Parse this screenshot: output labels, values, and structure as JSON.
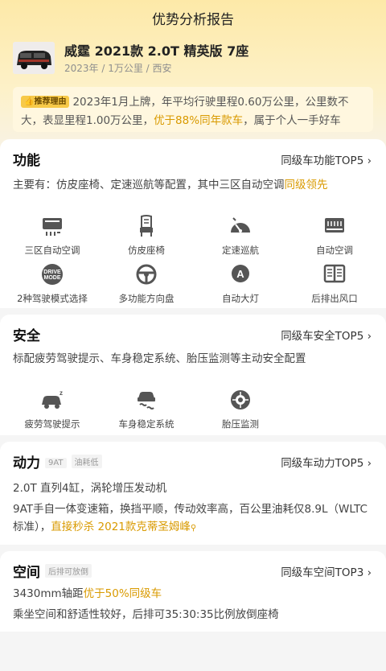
{
  "page": {
    "title": "优势分析报告"
  },
  "car": {
    "name": "威霆 2021款 2.0T 精英版 7座",
    "meta": "2023年 / 1万公里 / 西安"
  },
  "reason": {
    "badge": "推荐理由",
    "text_before": "2023年1月上牌，年平均行驶里程0.60万公里，公里数不大，表显里程1.00万公里，",
    "highlight": "优于88%同年款车",
    "text_after": "，属于个人一手好车"
  },
  "function": {
    "title": "功能",
    "link": "同级车功能TOP5",
    "summary_before": "主要有：仿皮座椅、定速巡航等配置，其中三区自动空调",
    "summary_highlight": "同级领先",
    "items": [
      {
        "label": "三区自动空调",
        "icon": "ac-zone-icon"
      },
      {
        "label": "仿皮座椅",
        "icon": "seat-icon"
      },
      {
        "label": "定速巡航",
        "icon": "cruise-icon"
      },
      {
        "label": "自动空调",
        "icon": "auto-ac-icon"
      },
      {
        "label": "2种驾驶模式选择",
        "icon": "drive-mode-icon",
        "icon_text": [
          "DRIVE",
          "MODE"
        ]
      },
      {
        "label": "多功能方向盘",
        "icon": "steering-wheel-icon"
      },
      {
        "label": "自动大灯",
        "icon": "auto-headlight-icon",
        "icon_text": [
          "A"
        ]
      },
      {
        "label": "后排出风口",
        "icon": "rear-vent-icon"
      }
    ]
  },
  "safety": {
    "title": "安全",
    "link": "同级车安全TOP5",
    "summary": "标配疲劳驾驶提示、车身稳定系统、胎压监测等主动安全配置",
    "items": [
      {
        "label": "疲劳驾驶提示",
        "icon": "fatigue-icon"
      },
      {
        "label": "车身稳定系统",
        "icon": "stability-icon"
      },
      {
        "label": "胎压监测",
        "icon": "tire-pressure-icon"
      }
    ]
  },
  "power": {
    "title": "动力",
    "tags": [
      "9AT",
      "油耗低"
    ],
    "link": "同级车动力TOP5",
    "line1": "2.0T 直列4缸，涡轮增压发动机",
    "line2_before": "9AT手自一体变速箱，换挡平顺，传动效率高，百公里油耗仅8.9L（WLTC标准），",
    "line2_highlight": "直接秒杀 2021款克蒂圣姆峰"
  },
  "space": {
    "title": "空间",
    "tags": [
      "后排可放倒"
    ],
    "link": "同级车空间TOP3",
    "line1_before": "3430mm轴距",
    "line1_highlight": "优于50%同级车",
    "line2": "乘坐空间和舒适性较好，后排可35:30:35比例放倒座椅"
  },
  "colors": {
    "accent": "#d99a00",
    "badge": "#f7c948",
    "header": "#fde9a8"
  }
}
